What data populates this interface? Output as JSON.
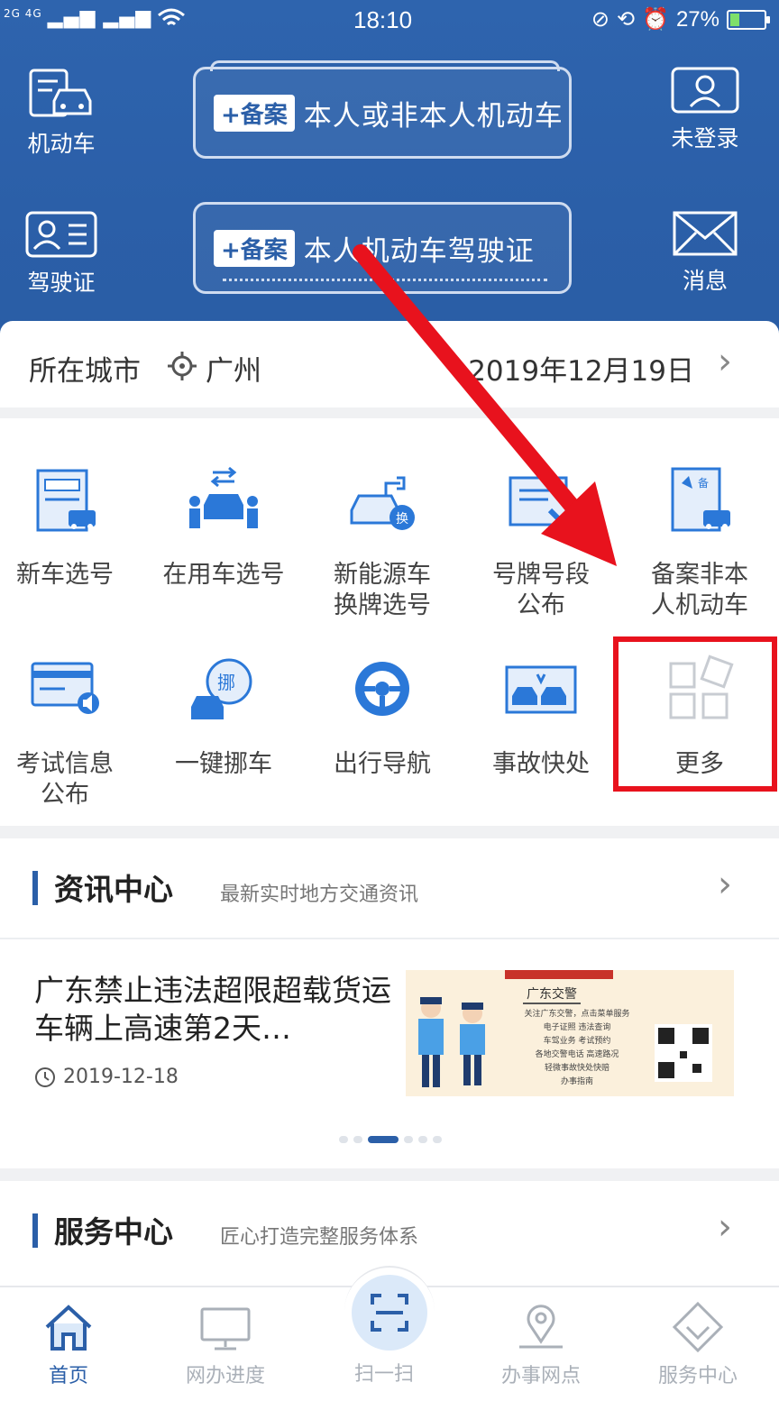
{
  "status_bar": {
    "network": "2G 4G",
    "time": "18:10",
    "battery": "27%",
    "battery_level": 0.27
  },
  "header": {
    "left_top": {
      "label": "机动车",
      "icon": "car-icon"
    },
    "left_bottom": {
      "label": "驾驶证",
      "icon": "license-icon"
    },
    "right_top": {
      "label": "未登录",
      "icon": "user-icon"
    },
    "right_bottom": {
      "label": "消息",
      "icon": "mail-icon"
    },
    "cards": [
      {
        "badge": "+备案",
        "text": "本人或非本人机动车"
      },
      {
        "badge": "+备案",
        "text": "本人机动车驾驶证"
      }
    ]
  },
  "city_row": {
    "label": "所在城市",
    "city": "广州",
    "date": "2019年12月19日"
  },
  "services": [
    {
      "label": "新车选号",
      "icon": "new-car-plate-icon"
    },
    {
      "label": "在用车选号",
      "icon": "used-car-plate-icon"
    },
    {
      "label": "新能源车\n换牌选号",
      "icon": "ev-car-icon"
    },
    {
      "label": "号牌号段\n公布",
      "icon": "plate-segment-icon"
    },
    {
      "label": "备案非本\n人机动车",
      "icon": "register-car-icon"
    },
    {
      "label": "考试信息\n公布",
      "icon": "exam-info-icon"
    },
    {
      "label": "一键挪车",
      "icon": "move-car-icon"
    },
    {
      "label": "出行导航",
      "icon": "steering-wheel-icon"
    },
    {
      "label": "事故快处",
      "icon": "accident-icon"
    },
    {
      "label": "更多",
      "icon": "more-grid-icon"
    }
  ],
  "news": {
    "title": "资讯中心",
    "subtitle": "最新实时地方交通资讯",
    "article_title": "广东禁止违法超限超载货运车辆上高速第2天…",
    "article_date": "2019-12-18",
    "thumb_caption": "广东交警",
    "thumb_lines": [
      "关注广东交警，点击菜单服务",
      "电子证照  违法查询",
      "车驾业务  考试预约",
      "各地交警电话  高速路况",
      "轻微事故快处快赔",
      "办事指南"
    ],
    "page_count": 6,
    "page_active": 2
  },
  "service_center": {
    "title": "服务中心",
    "subtitle": "匠心打造完整服务体系"
  },
  "bottom_nav": [
    {
      "label": "首页",
      "icon": "home-icon",
      "active": true
    },
    {
      "label": "网办进度",
      "icon": "monitor-icon",
      "active": false
    },
    {
      "label": "扫一扫",
      "icon": "scan-icon",
      "active": false
    },
    {
      "label": "办事网点",
      "icon": "location-pin-icon",
      "active": false
    },
    {
      "label": "服务中心",
      "icon": "service-diamond-icon",
      "active": false
    }
  ],
  "colors": {
    "primary": "#2b5fa8",
    "annotation_red": "#e8121d"
  }
}
